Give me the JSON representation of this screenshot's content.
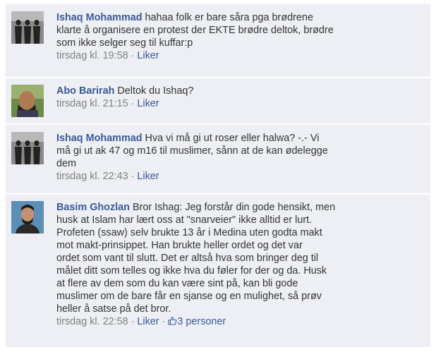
{
  "comments": [
    {
      "author": "Ishaq Mohammad",
      "lines": [
        "hahaa folk er bare såra pga brødrene",
        "klarte å organisere en protest der EKTE brødre deltok, brødre",
        "som ikke selger seg til kuffar:p"
      ],
      "time": "tirsdag kl. 19:58",
      "sep": "·",
      "like": "Liker"
    },
    {
      "author": "Abo Barirah",
      "lines": [
        "Deltok du Ishaq?"
      ],
      "time": "tirsdag kl. 21:15",
      "sep": "·",
      "like": "Liker"
    },
    {
      "author": "Ishaq Mohammad",
      "lines": [
        "Hva vi må gi ut roser eller halwa? -.- Vi",
        "må gi ut ak 47 og m16 til muslimer, sånn at de kan ødelegge",
        "dem"
      ],
      "time": "tirsdag kl. 22:43",
      "sep": "·",
      "like": "Liker"
    },
    {
      "author": "Basim Ghozlan",
      "lines": [
        "Bror Ishag: Jeg forstår din gode hensikt, men",
        "husk at Islam har lært oss at \"snarveier\" ikke alltid er lurt.",
        "Profeten (ssaw) selv brukte 13 år i Medina uten godta makt",
        "mot makt-prinsippet. Han brukte heller ordet og det var",
        "ordet som vant til slutt. Det er altså hva som bringer deg til",
        "målet ditt som telles og ikke hva du føler for der og da. Husk",
        "at flere av dem som du kan være sint på, kan bli gode",
        "muslimer om de bare får en sjanse og en mulighet, så prøv",
        "heller å satse på det bror."
      ],
      "time": "tirsdag kl. 22:58",
      "sep": "·",
      "like": "Liker",
      "sep2": "·",
      "likes_count": "3 personer"
    }
  ],
  "colors": {
    "background": "#edeff4",
    "link": "#3b5998",
    "meta": "#808080"
  },
  "icons": {
    "thumb": "thumbs-up-icon"
  }
}
